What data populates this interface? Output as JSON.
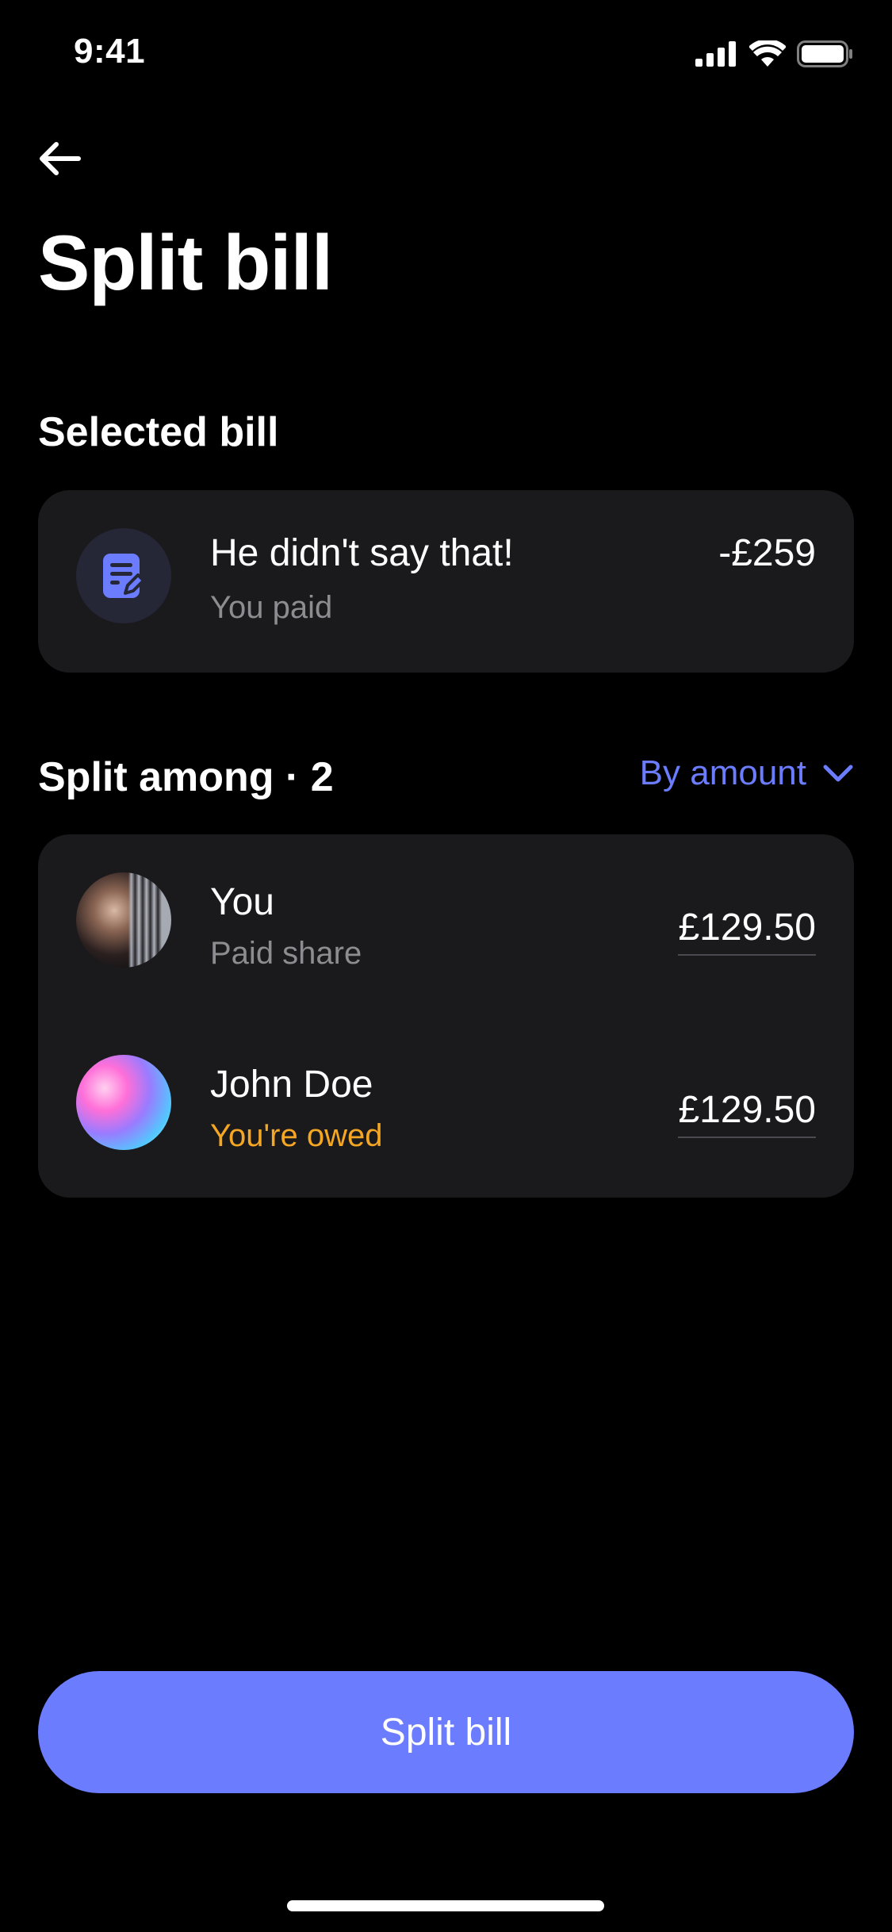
{
  "status_bar": {
    "time": "9:41"
  },
  "header": {
    "title": "Split bill"
  },
  "selected_bill": {
    "section_label": "Selected bill",
    "name": "He didn't say that!",
    "subtitle": "You paid",
    "amount": "-£259"
  },
  "split": {
    "section_label": "Split among · 2",
    "mode_label": "By amount",
    "participants": [
      {
        "name": "You",
        "status": "Paid share",
        "amount": "£129.50",
        "status_color": "#8c8c91"
      },
      {
        "name": "John Doe",
        "status": "You're owed",
        "amount": "£129.50",
        "status_color": "#f5a623"
      }
    ]
  },
  "cta": {
    "label": "Split bill"
  },
  "colors": {
    "accent": "#6b7cff",
    "card": "#1a1a1d",
    "owed": "#f5a623"
  }
}
